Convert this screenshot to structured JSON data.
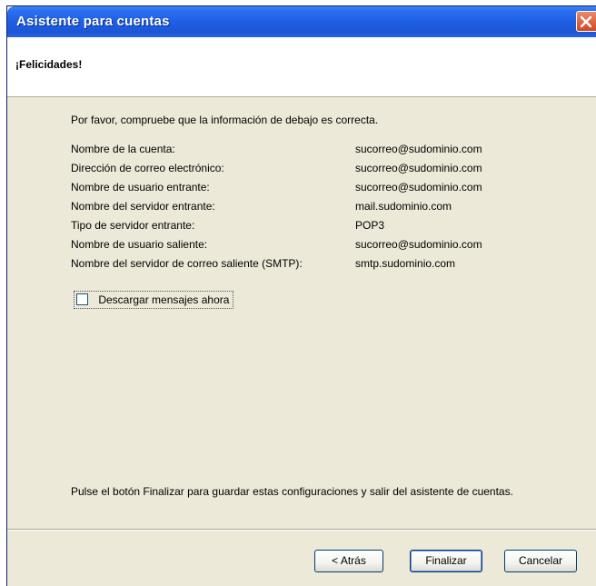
{
  "window": {
    "title": "Asistente para cuentas"
  },
  "header": {
    "title": "¡Felicidades!"
  },
  "intro": "Por favor, compruebe que la información de debajo es correcta.",
  "info": [
    {
      "label": "Nombre de la cuenta:",
      "value": "sucorreo@sudominio.com"
    },
    {
      "label": "Dirección de correo electrónico:",
      "value": "sucorreo@sudominio.com"
    },
    {
      "label": "Nombre de usuario entrante:",
      "value": "sucorreo@sudominio.com"
    },
    {
      "label": "Nombre del servidor entrante:",
      "value": "mail.sudominio.com"
    },
    {
      "label": "Tipo de servidor entrante:",
      "value": "POP3"
    },
    {
      "label": "Nombre de usuario saliente:",
      "value": "sucorreo@sudominio.com"
    },
    {
      "label": "Nombre del servidor de correo saliente (SMTP):",
      "value": "smtp.sudominio.com"
    }
  ],
  "checkbox": {
    "label": "Descargar mensajes ahora",
    "checked": false
  },
  "footer": "Pulse el botón Finalizar para guardar estas configuraciones y salir del asistente de cuentas.",
  "buttons": {
    "back": "< Atrás",
    "finish": "Finalizar",
    "cancel": "Cancelar"
  },
  "icons": {
    "close": "close-icon"
  },
  "colors": {
    "titlebar": "#1f5fe3",
    "close": "#d2471f",
    "dialog_bg": "#ece9d8"
  }
}
